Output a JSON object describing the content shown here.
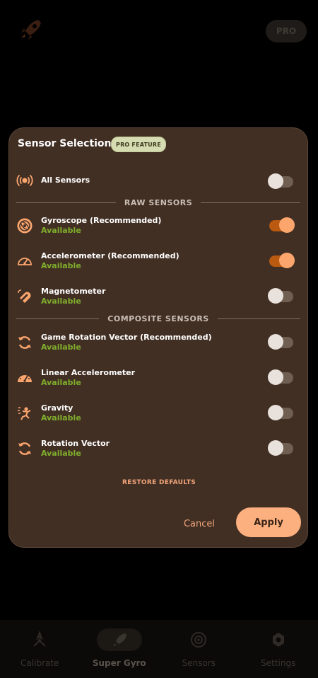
{
  "background": {
    "pro_label": "PRO",
    "nav": [
      {
        "label": "Calibrate",
        "icon": "calibrate-icon"
      },
      {
        "label": "Super Gyro",
        "icon": "rocket-icon"
      },
      {
        "label": "Sensors",
        "icon": "sensors-icon"
      },
      {
        "label": "Settings",
        "icon": "gear-icon"
      }
    ]
  },
  "dialog": {
    "title": "Sensor Selection",
    "badge": "PRO FEATURE",
    "all_sensors": {
      "label": "All Sensors",
      "icon": "all-sensors-icon",
      "enabled": false
    },
    "sections": {
      "raw": "RAW SENSORS",
      "composite": "COMPOSITE SENSORS"
    },
    "raw_sensors": [
      {
        "name": "Gyroscope (Recommended)",
        "status": "Available",
        "icon": "gyroscope-icon",
        "enabled": true
      },
      {
        "name": "Accelerometer (Recommended)",
        "status": "Available",
        "icon": "speedometer-icon",
        "enabled": true
      },
      {
        "name": "Magnetometer",
        "status": "Available",
        "icon": "magnet-icon",
        "enabled": false
      }
    ],
    "composite_sensors": [
      {
        "name": "Game Rotation Vector (Recommended)",
        "status": "Available",
        "icon": "rotation-icon",
        "enabled": false
      },
      {
        "name": "Linear Accelerometer",
        "status": "Available",
        "icon": "speedometer-icon",
        "enabled": false
      },
      {
        "name": "Gravity",
        "status": "Available",
        "icon": "gravity-icon",
        "enabled": false
      },
      {
        "name": "Rotation Vector",
        "status": "Available",
        "icon": "rotation-icon",
        "enabled": false
      }
    ],
    "restore_label": "RESTORE DEFAULTS",
    "cancel_label": "Cancel",
    "apply_label": "Apply"
  },
  "colors": {
    "accent": "#fca66e",
    "toggle_on_track": "#ba5a10",
    "available": "#7fae2c",
    "dialog_bg": "#422f24"
  }
}
